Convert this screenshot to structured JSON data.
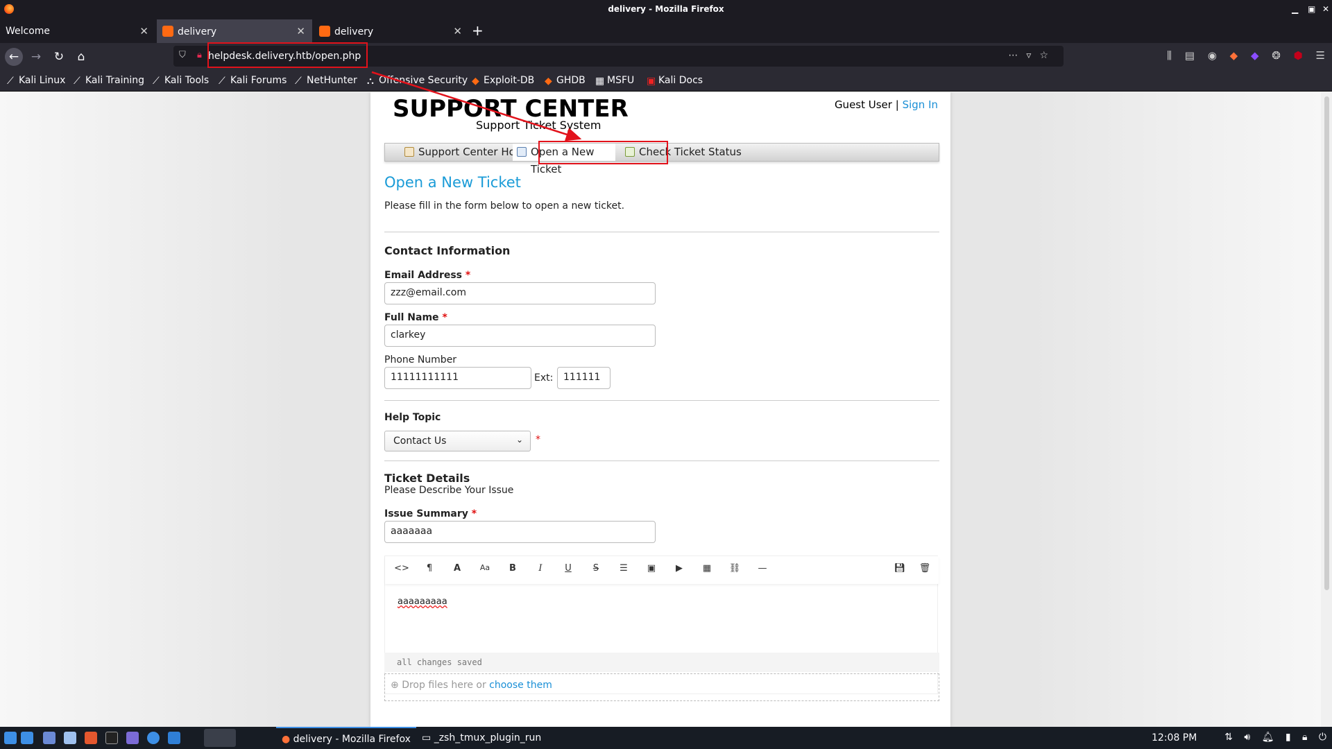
{
  "window": {
    "title": "delivery - Mozilla Firefox"
  },
  "tabs": [
    {
      "label": "Welcome"
    },
    {
      "label": "delivery"
    },
    {
      "label": "delivery"
    }
  ],
  "urlbar": {
    "url": "helpdesk.delivery.htb/open.php"
  },
  "bookmarks": [
    {
      "label": "Kali Linux",
      "icon": "kali-dragon-icon"
    },
    {
      "label": "Kali Training",
      "icon": "kali-dragon-icon"
    },
    {
      "label": "Kali Tools",
      "icon": "kali-dragon-icon"
    },
    {
      "label": "Kali Forums",
      "icon": "kali-dragon-icon"
    },
    {
      "label": "NetHunter",
      "icon": "kali-dragon-icon"
    },
    {
      "label": "Offensive Security",
      "icon": "offsec-icon"
    },
    {
      "label": "Exploit-DB",
      "icon": "exploitdb-icon"
    },
    {
      "label": "GHDB",
      "icon": "ghdb-icon"
    },
    {
      "label": "MSFU",
      "icon": "msfu-icon"
    },
    {
      "label": "Kali Docs",
      "icon": "kali-docs-icon"
    }
  ],
  "site": {
    "logo_title": "SUPPORT CENTER",
    "logo_subtitle": "Support Ticket System",
    "user": "Guest User",
    "separator": "|",
    "signin": "Sign In",
    "nav": {
      "home": "Support Center Home",
      "open": "Open a New Ticket",
      "status": "Check Ticket Status"
    }
  },
  "form": {
    "heading": "Open a New Ticket",
    "intro": "Please fill in the form below to open a new ticket.",
    "contact_heading": "Contact Information",
    "email_label": "Email Address",
    "email_value": "zzz@email.com",
    "name_label": "Full Name",
    "name_value": "clarkey",
    "phone_label": "Phone Number",
    "phone_value": "11111111111",
    "ext_label": "Ext:",
    "ext_value": "111111",
    "required_mark": "*",
    "topic_heading": "Help Topic",
    "topic_value": "Contact Us",
    "details_heading": "Ticket Details",
    "details_sub": "Please Describe Your Issue",
    "summary_label": "Issue Summary",
    "summary_value": "aaaaaaa",
    "editor_text": "aaaaaaaaa",
    "editor_status": "all changes saved",
    "drop_text": "Drop files here or",
    "drop_link": "choose them"
  },
  "taskbar": {
    "tasks": [
      {
        "label": "delivery - Mozilla Firefox"
      },
      {
        "label": "_zsh_tmux_plugin_run"
      }
    ],
    "clock": "12:08 PM"
  }
}
